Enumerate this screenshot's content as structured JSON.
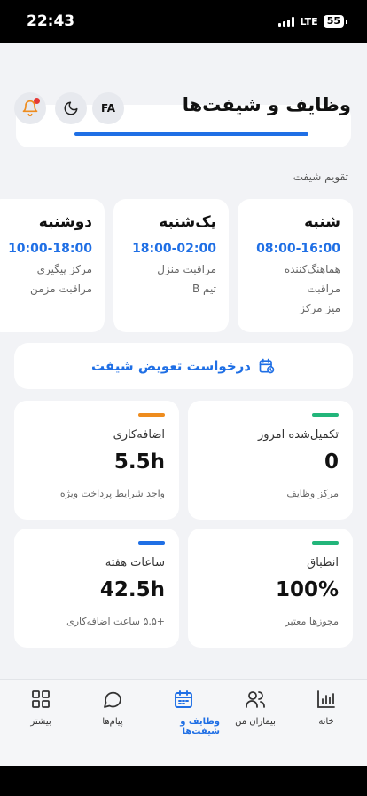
{
  "status": {
    "time": "22:43",
    "network": "LTE",
    "battery": "55"
  },
  "header": {
    "title": "وظایف و شیفت‌ها",
    "lang_label": "FA",
    "theme_icon": "moon-icon",
    "notif_icon": "bell-icon"
  },
  "schedule": {
    "title": "تقویم شیفت",
    "days": [
      {
        "day": "شنبه",
        "time": "08:00-16:00",
        "lines": [
          "هماهنگ‌کننده",
          "مراقبت",
          "میز مرکز"
        ]
      },
      {
        "day": "یک‌شنبه",
        "time": "18:00-02:00",
        "lines": [
          "مراقبت منزل",
          "تیم B"
        ]
      },
      {
        "day": "دوشنبه",
        "time": "10:00-18:00",
        "lines": [
          "مرکز پیگیری",
          "مراقبت مزمن"
        ]
      }
    ]
  },
  "swap": {
    "label": "درخواست تعویض شیفت",
    "icon": "calendar-clock-icon"
  },
  "stats": [
    {
      "label": "تکمیل‌شده امروز",
      "value": "0",
      "sub": "مرکز وظایف",
      "accent": "#22b57a"
    },
    {
      "label": "اضافه‌کاری",
      "value": "5.5h",
      "sub": "واجد شرایط پرداخت ویژه",
      "accent": "#ee8c1e"
    },
    {
      "label": "انطباق",
      "value": "100%",
      "sub": "مجوزها معتبر",
      "accent": "#22b57a"
    },
    {
      "label": "ساعات هفته",
      "value": "42.5h",
      "sub": "+۵.۵ ساعت اضافه‌کاری",
      "accent": "#1f6fe5"
    }
  ],
  "nav": [
    {
      "label": "خانه",
      "icon": "chart-bars-icon"
    },
    {
      "label": "بیماران من",
      "icon": "users-icon"
    },
    {
      "label": "وظایف و شیفت‌ها",
      "icon": "calendar-icon",
      "active": true
    },
    {
      "label": "پیام‌ها",
      "icon": "chat-bubble-icon"
    },
    {
      "label": "بیشتر",
      "icon": "grid-icon"
    }
  ],
  "colors": {
    "accent": "#1f6fe5",
    "background": "#f2f3f6"
  }
}
